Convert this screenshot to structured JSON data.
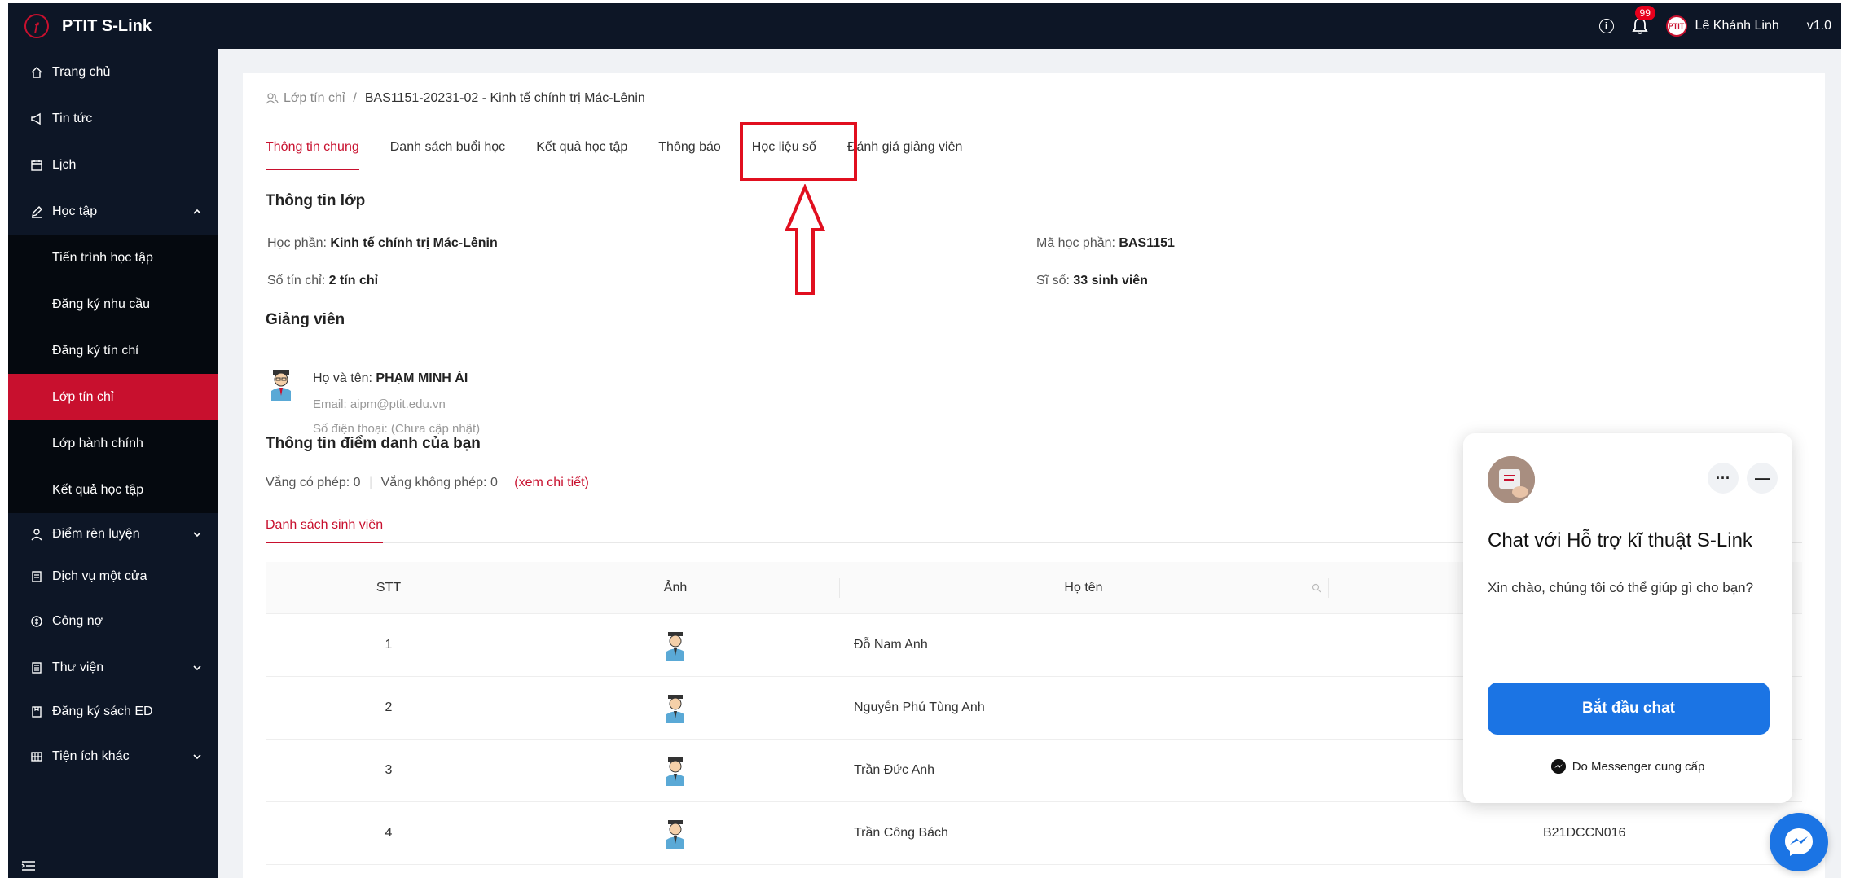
{
  "topbar": {
    "app_name": "PTIT S-Link",
    "notification_count": "99",
    "user_name": "Lê Khánh Linh",
    "version": "v1.0",
    "logo_text": "PTIT"
  },
  "sidebar": {
    "items": [
      {
        "label": "Trang chủ",
        "icon": "home-icon"
      },
      {
        "label": "Tin tức",
        "icon": "megaphone-icon"
      },
      {
        "label": "Lịch",
        "icon": "calendar-icon"
      },
      {
        "label": "Học tập",
        "icon": "pen-icon"
      },
      {
        "label": "Tiến trình học tập"
      },
      {
        "label": "Đăng ký nhu cầu"
      },
      {
        "label": "Đăng ký tín chỉ"
      },
      {
        "label": "Lớp tín chỉ"
      },
      {
        "label": "Lớp hành chính"
      },
      {
        "label": "Kết quả học tập"
      },
      {
        "label": "Điểm rèn luyện",
        "icon": "user-icon"
      },
      {
        "label": "Dịch vụ một cửa",
        "icon": "document-icon"
      },
      {
        "label": "Công nợ",
        "icon": "money-icon"
      },
      {
        "label": "Thư viện",
        "icon": "book-icon"
      },
      {
        "label": "Đăng ký sách ED",
        "icon": "notebook-icon"
      },
      {
        "label": "Tiện ích khác",
        "icon": "grid-icon"
      }
    ]
  },
  "breadcrumb": {
    "parent": "Lớp tín chỉ",
    "separator": "/",
    "current": "BAS1151-20231-02 - Kinh tế chính trị Mác-Lênin"
  },
  "tabs": [
    "Thông tin chung",
    "Danh sách buổi học",
    "Kết quả học tập",
    "Thông báo",
    "Học liệu số",
    "Đánh giá giảng viên"
  ],
  "class_info": {
    "title": "Thông tin lớp",
    "course_label": "Học phần:",
    "course_value": "Kinh tế chính trị Mác-Lênin",
    "code_label": "Mã học phần:",
    "code_value": "BAS1151",
    "credits_label": "Số tín chỉ:",
    "credits_value": "2 tín chỉ",
    "size_label": "Sĩ số:",
    "size_value": "33 sinh viên"
  },
  "lecturer": {
    "title": "Giảng viên",
    "name_label": "Họ và tên:",
    "name_value": "PHẠM MINH ÁI",
    "email": "Email: aipm@ptit.edu.vn",
    "phone": "Số điện thoại: (Chưa cập nhật)"
  },
  "attendance": {
    "title": "Thông tin điểm danh của bạn",
    "excused": "Vắng có phép: 0",
    "unexcused": "Vắng không phép: 0",
    "detail_link": "(xem chi tiết)"
  },
  "students": {
    "tab_label": "Danh sách sinh viên",
    "headers": {
      "stt": "STT",
      "photo": "Ảnh",
      "name": "Họ tên"
    },
    "rows": [
      {
        "stt": "1",
        "name": "Đỗ Nam Anh",
        "code": ""
      },
      {
        "stt": "2",
        "name": "Nguyễn Phú Tùng Anh",
        "code": ""
      },
      {
        "stt": "3",
        "name": "Trần Đức Anh",
        "code": ""
      },
      {
        "stt": "4",
        "name": "Trần Công Bách",
        "code": "B21DCCN016"
      }
    ]
  },
  "chat": {
    "title": "Chat với Hỗ trợ kĩ thuật S-Link",
    "message": "Xin chào, chúng tôi có thể giúp gì cho bạn?",
    "start_button": "Bắt đầu chat",
    "powered_by": "Do Messenger cung cấp",
    "more_button": "···",
    "minimize_button": "—"
  },
  "colors": {
    "brand_red": "#c8102e",
    "sidebar_bg": "#0d1626",
    "annotation_red": "#e10f1f",
    "messenger_blue": "#1b74e4"
  }
}
